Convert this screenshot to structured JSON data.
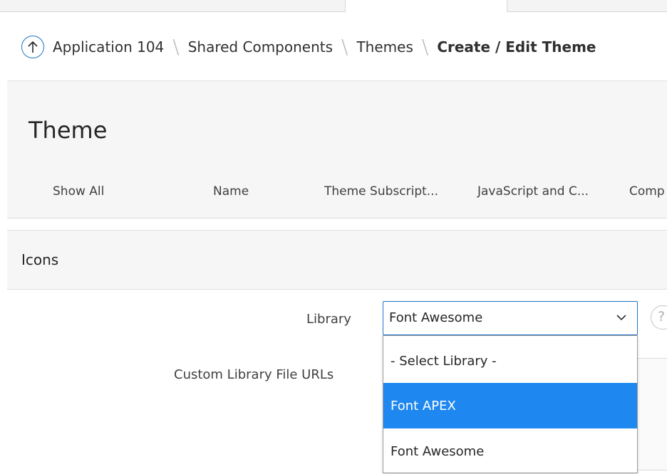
{
  "breadcrumb": {
    "items": [
      "Application 104",
      "Shared Components",
      "Themes"
    ],
    "current": "Create / Edit Theme"
  },
  "header": {
    "title": "Theme",
    "tabs": [
      "Show All",
      "Name",
      "Theme Subscript...",
      "JavaScript and C...",
      "Comp"
    ]
  },
  "region": {
    "title": "Icons"
  },
  "form": {
    "library_label": "Library",
    "library_value": "Font Awesome",
    "custom_urls_label": "Custom Library File URLs",
    "help_glyph": "?"
  },
  "dropdown": {
    "options": [
      "- Select Library -",
      "Font APEX",
      "Font Awesome"
    ],
    "highlighted_index": 1
  },
  "colors": {
    "accent": "#1d73c9",
    "highlight": "#1e87f0",
    "panel_bg": "#f6f6f6"
  }
}
